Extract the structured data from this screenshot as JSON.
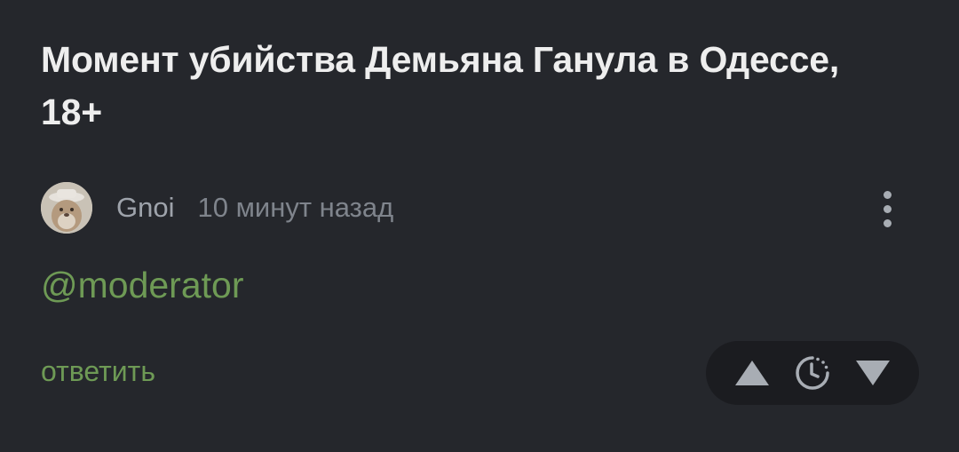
{
  "post": {
    "title": "Момент убийства Демьяна Ганула в Одессе, 18+"
  },
  "comment": {
    "author": "Gnoi",
    "timestamp": "10 минут назад",
    "text": "@moderator",
    "reply_label": "ответить"
  },
  "icons": {
    "more": "more-vertical-icon",
    "upvote": "triangle-up-icon",
    "save": "clock-icon",
    "downvote": "triangle-down-icon"
  },
  "colors": {
    "background": "#25272c",
    "title": "#eeeeee",
    "author": "#9ea3ab",
    "timestamp": "#7f848c",
    "accent_green": "#6e9a55",
    "vote_bar": "#1b1c20",
    "vote_icon": "#a8adb4"
  }
}
